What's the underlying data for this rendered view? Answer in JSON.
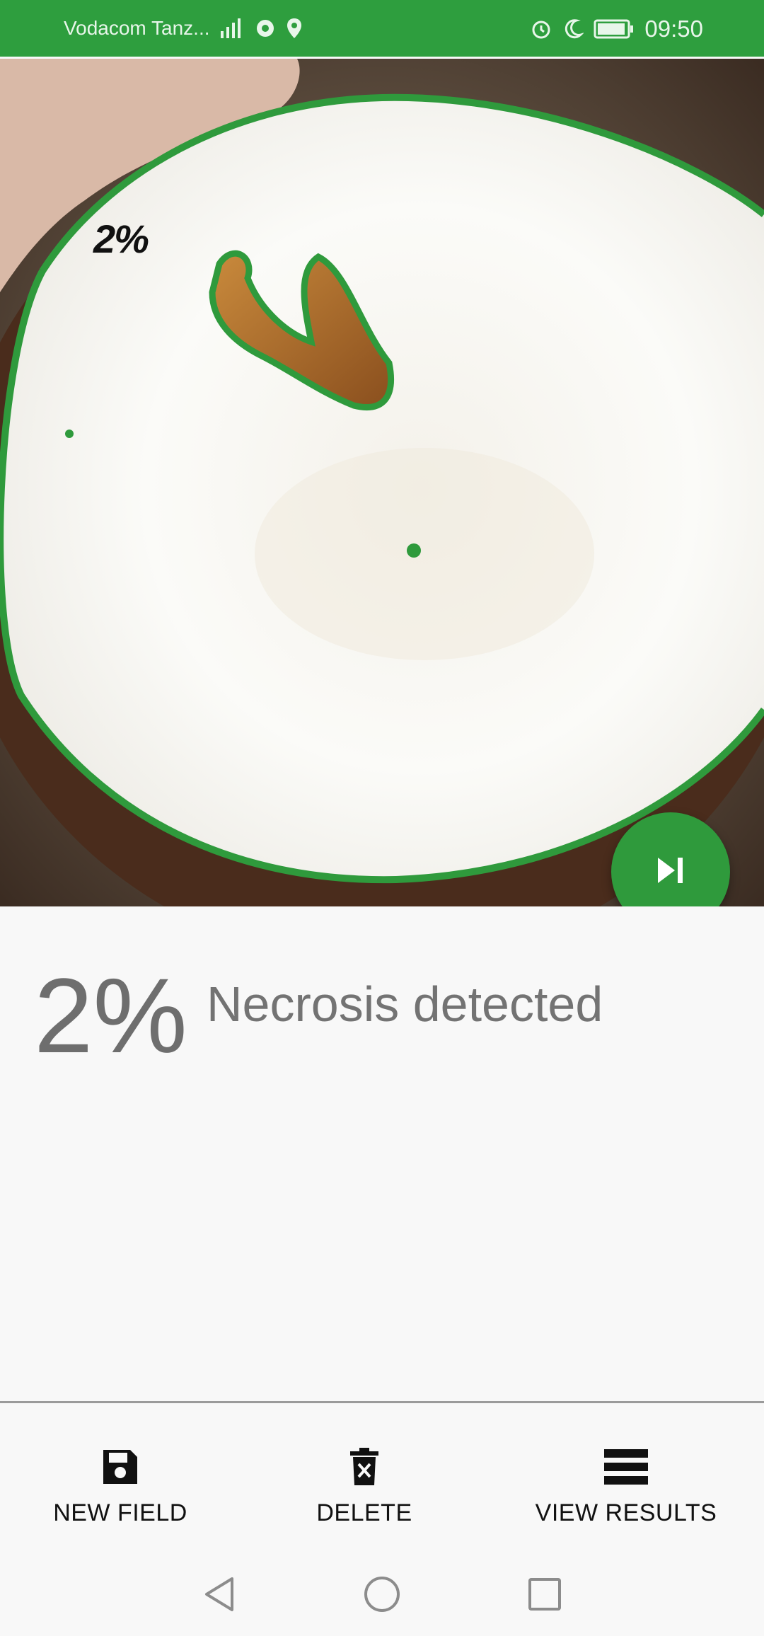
{
  "status_bar": {
    "carrier": "Vodacom Tanz...",
    "time": "09:50"
  },
  "image_overlay": {
    "percent_label": "2%"
  },
  "result": {
    "percent": "2%",
    "label": "Necrosis detected"
  },
  "bottom_nav": {
    "new_field": "NEW FIELD",
    "delete": "DELETE",
    "view_results": "VIEW RESULTS"
  },
  "colors": {
    "primary": "#2e9e3e",
    "contour": "#2f9a3c",
    "text_muted": "#737373"
  },
  "icons": {
    "fab": "skip-next-icon",
    "new_field": "save-icon",
    "delete": "delete-icon",
    "view_results": "list-icon",
    "system": [
      "back-icon",
      "home-icon",
      "recents-icon"
    ]
  }
}
